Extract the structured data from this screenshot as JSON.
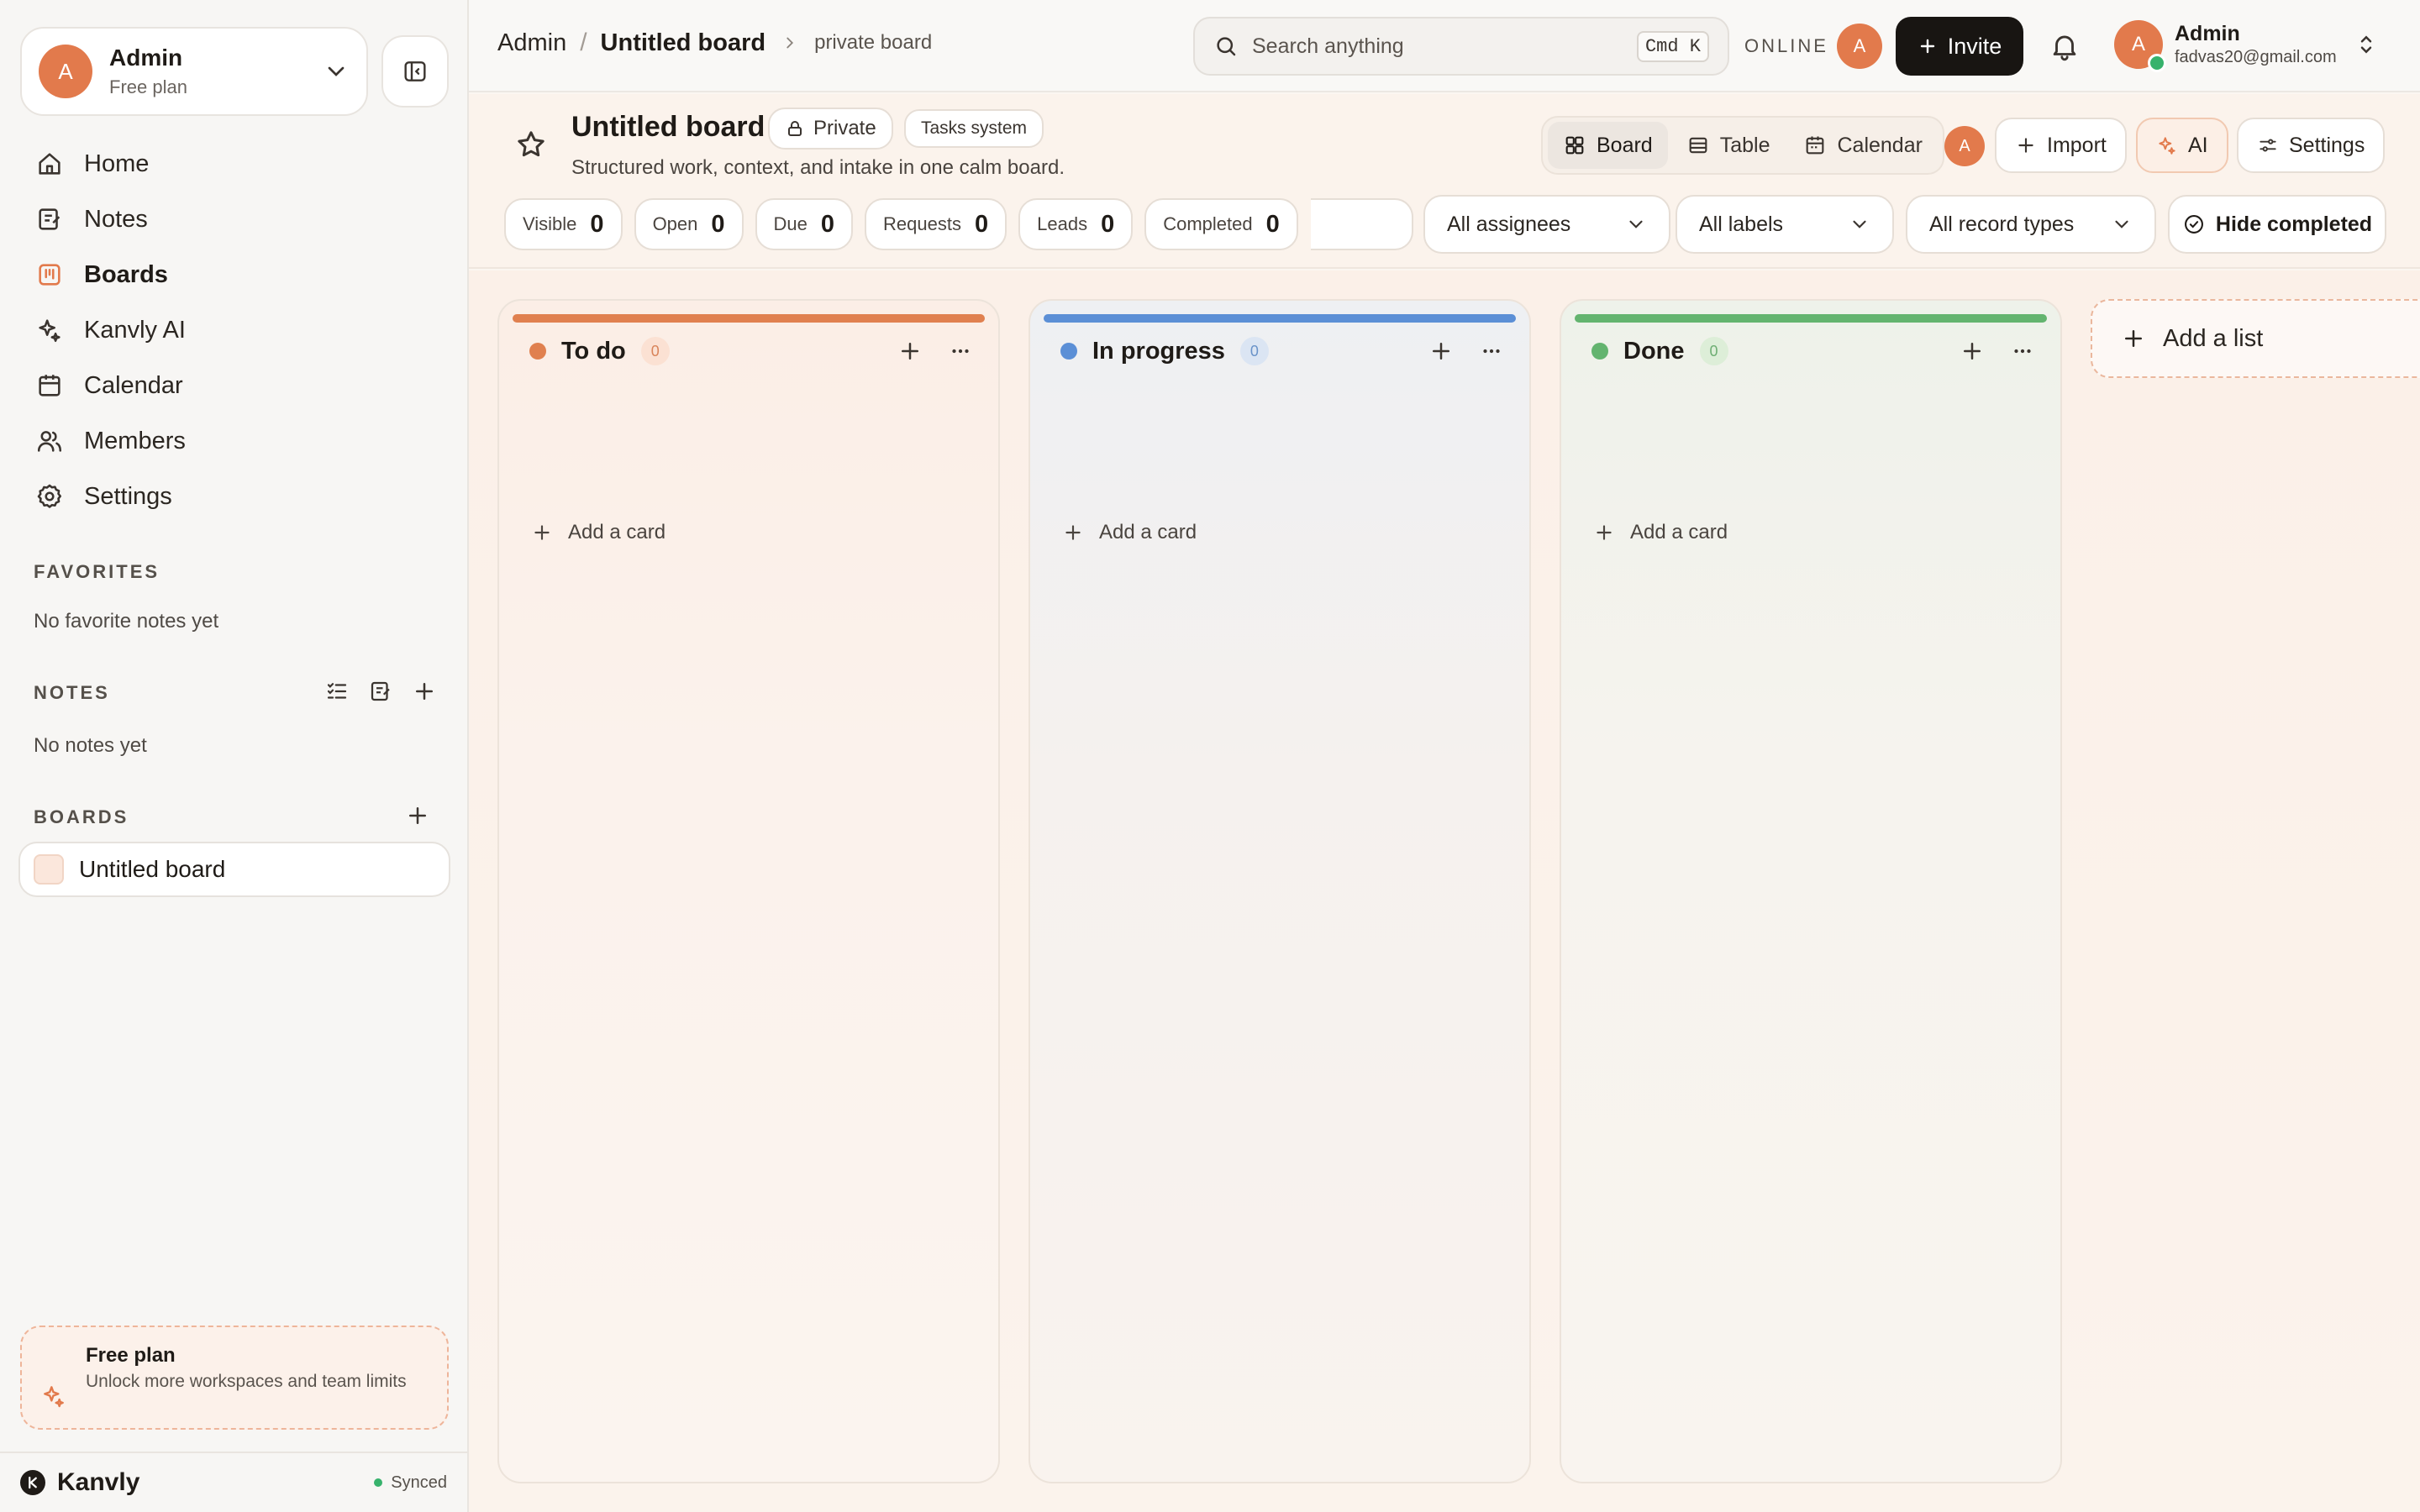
{
  "workspace": {
    "avatar_letter": "A",
    "name": "Admin",
    "plan": "Free plan"
  },
  "sidebar": {
    "nav": [
      {
        "label": "Home",
        "icon": "home-icon"
      },
      {
        "label": "Notes",
        "icon": "notes-icon"
      },
      {
        "label": "Boards",
        "icon": "boards-icon",
        "active": true
      },
      {
        "label": "Kanvly AI",
        "icon": "sparkle-icon"
      },
      {
        "label": "Calendar",
        "icon": "calendar-icon"
      },
      {
        "label": "Members",
        "icon": "members-icon"
      },
      {
        "label": "Settings",
        "icon": "gear-icon"
      }
    ],
    "favorites_title": "FAVORITES",
    "favorites_empty": "No favorite notes yet",
    "notes_title": "NOTES",
    "notes_empty": "No notes yet",
    "boards_title": "BOARDS",
    "boards": [
      {
        "label": "Untitled board"
      }
    ],
    "plan_card": {
      "title": "Free plan",
      "desc": "Unlock more workspaces and team limits"
    },
    "brand": "Kanvly",
    "sync_status": "Synced"
  },
  "topbar": {
    "crumb_root": "Admin",
    "crumb_board": "Untitled board",
    "crumb_sub": "private board",
    "search_placeholder": "Search anything",
    "search_shortcut": "Cmd K",
    "online_label": "ONLINE",
    "online_avatar": "A",
    "invite_label": "Invite",
    "user": {
      "avatar_letter": "A",
      "name": "Admin",
      "email": "fadvas20@gmail.com"
    }
  },
  "board": {
    "title": "Untitled board",
    "privacy": "Private",
    "tag": "Tasks system",
    "description": "Structured work, context, and intake in one calm board.",
    "views": [
      "Board",
      "Table",
      "Calendar"
    ],
    "active_view": "Board",
    "member_avatar": "A",
    "import_label": "Import",
    "ai_label": "AI",
    "settings_label": "Settings",
    "stats": [
      {
        "label": "Visible",
        "value": "0"
      },
      {
        "label": "Open",
        "value": "0"
      },
      {
        "label": "Due",
        "value": "0"
      },
      {
        "label": "Requests",
        "value": "0"
      },
      {
        "label": "Leads",
        "value": "0"
      },
      {
        "label": "Completed",
        "value": "0"
      }
    ],
    "filters": {
      "assignees": "All assignees",
      "labels": "All labels",
      "record_types": "All record types"
    },
    "hide_completed_label": "Hide completed",
    "columns": [
      {
        "title": "To do",
        "count": "0",
        "color": "#e0804f",
        "add_label": "Add a card"
      },
      {
        "title": "In progress",
        "count": "0",
        "color": "#5b8fd6",
        "add_label": "Add a card"
      },
      {
        "title": "Done",
        "count": "0",
        "color": "#63b46f",
        "add_label": "Add a card"
      }
    ],
    "add_list_label": "Add a list"
  },
  "colors": {
    "accent": "#e27a4c",
    "invite_bg": "#181512",
    "online_green": "#37b26c"
  }
}
